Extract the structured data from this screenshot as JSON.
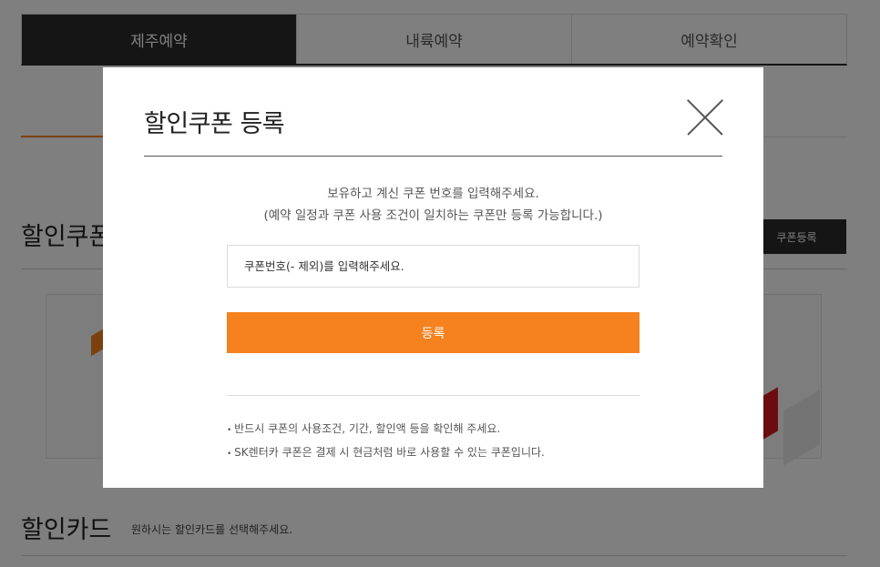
{
  "tabs": [
    {
      "label": "제주예약",
      "active": true
    },
    {
      "label": "내륙예약",
      "active": false
    },
    {
      "label": "예약확인",
      "active": false
    }
  ],
  "background": {
    "coupon_section_title": "할인쿠폰",
    "coupon_register_label": "쿠폰등록",
    "card_section_title": "할인카드",
    "card_section_subtitle": "원하시는 할인카드를 선택해주세요."
  },
  "modal": {
    "title": "할인쿠폰 등록",
    "description_line1": "보유하고 계신 쿠폰 번호를 입력해주세요.",
    "description_line2": "(예약 일정과 쿠폰 사용 조건이 일치하는 쿠폰만 등록 가능합니다.)",
    "input_placeholder": "쿠폰번호(- 제외)를 입력해주세요.",
    "input_value": "",
    "submit_label": "등록",
    "notes": [
      "반드시 쿠폰의 사용조건, 기간, 할인액 등을 확인해 주세요.",
      "SK렌터카 쿠폰은 결제 시 현금처럼 바로 사용할 수 있는 쿠폰입니다."
    ]
  },
  "colors": {
    "accent": "#f5821f",
    "dark": "#2b2b2b",
    "overlay": "rgba(0,0,0,0.5)"
  }
}
